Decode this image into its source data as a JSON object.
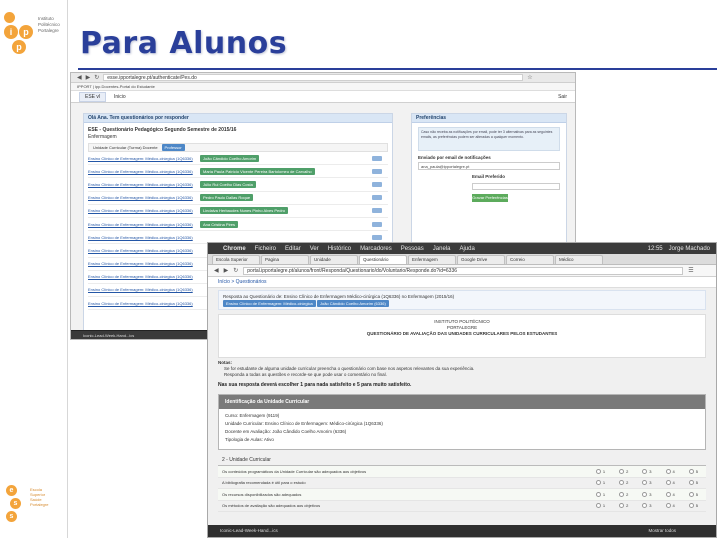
{
  "slide": {
    "title": "Para Alunos",
    "ipp_logo_text": [
      "Instituto",
      "Politécnico",
      "Portalegre"
    ],
    "ipp_logo_letters": [
      "i",
      "p",
      "p"
    ],
    "ess_logo_text": [
      "Escola",
      "Superior",
      "Saúde",
      "Portalegre"
    ],
    "ess_logo_letters": [
      "e",
      "s",
      "s"
    ],
    "title_color": "#2a3f9a",
    "logo_color": "#f3a43b"
  },
  "screenshot1": {
    "url": "esse.ipportalegre.pt/authenticate/Pes.do",
    "bookmarks": "IPPORT  |  ipp.Docentes-Portal do Estudante",
    "app_tab": "ESE vl",
    "app_home": "Inicio",
    "user": "Sair",
    "panel_title": "Olá Ana. Tem questionários por responder",
    "survey_title": "ESE - Questionário Pedagógico Segundo Semestre de 2015/16",
    "course": "Enfermagem",
    "uc_header_label": "Unidade Curricular (Turma) Docente",
    "uc_header_chip": "Professor",
    "rows": [
      {
        "uc": "Ensino Clínico de Enfermagem: Médico-cirúrgica (1Q6336)",
        "teacher": "João Cândido Coelho Amorim"
      },
      {
        "uc": "Ensino Clínico de Enfermagem: Médico-cirúrgica (1Q6336)",
        "teacher": "Maria Paula Patrício Vicente Pereira Bartolomeu de Carvalho"
      },
      {
        "uc": "Ensino Clínico de Enfermagem: Médico-cirúrgica (1Q6336)",
        "teacher": "Júlio Rui Coelho Dias Costa"
      },
      {
        "uc": "Ensino Clínico de Enfermagem: Médico-cirúrgica (1Q6336)",
        "teacher": "Pedro Paulo Dallas Roque"
      },
      {
        "uc": "Ensino Clínico de Enfermagem: Médico-cirúrgica (1Q6336)",
        "teacher": "Lindalva Herbaudes Nunes Pinho Alves Pedro"
      },
      {
        "uc": "Ensino Clínico de Enfermagem: Médico-cirúrgica (1Q6336)",
        "teacher": "Ana Cristina Pires"
      },
      {
        "uc": "Ensino Clínico de Enfermagem: Médico-cirúrgica (1Q6336)",
        "teacher": ""
      },
      {
        "uc": "Ensino Clínico de Enfermagem: Médico-cirúrgica (1Q6336)",
        "teacher": ""
      },
      {
        "uc": "Ensino Clínico de Enfermagem: Médico-cirúrgica (1Q6336)",
        "teacher": ""
      },
      {
        "uc": "Ensino Clínico de Enfermagem: Médico-cirúrgica (1Q6336)",
        "teacher": ""
      },
      {
        "uc": "Ensino Clínico de Enfermagem: Médico-cirúrgica (1Q6336)",
        "teacher": ""
      },
      {
        "uc": "Ensino Clínico de Enfermagem: Médico-cirúrgica (1Q6336)",
        "teacher": ""
      }
    ],
    "side_title": "Preferências",
    "side_note": "Caso não receba as notificações por email, pode ter 3 alternativas para as seguintes emails, as preferências podem ser alteradas a qualquer momento.",
    "side_email_label": "Enviado por email de notificações",
    "side_email_value": "ana_paula@ipportalegre.pt",
    "side_field_label": "Email Preferido",
    "side_button": "Gravar Preferências",
    "status": "Iconic-Lead-Week-Hand...ics"
  },
  "screenshot2": {
    "menu": [
      "Chrome",
      "Ficheiro",
      "Editar",
      "Ver",
      "Histórico",
      "Marcadores",
      "Pessoas",
      "Janela",
      "Ajuda"
    ],
    "menu_right": "Jorge Machado",
    "clock": "12:55",
    "tabs": [
      "Escola Superior",
      "Pagina",
      "Unidade",
      "Questionário",
      "Enfermagem",
      "Google Drive",
      "Correio",
      "Médico"
    ],
    "url": "portal.ipportalegre.pt/alunos/front/Responda/Questionario/do/Voluntario/Responde.do?id=6336",
    "breadcrumb": "Início > Questionários",
    "ident_line1": "Resposta ao Questionário de: Ensino Clínico de Enfermagem Médico-cirúrgica (1Q6336) no Enfermagem (2015/16)",
    "ident_line2": "Docente: João Cândido Coelho Amorim",
    "ident_chip1": "Ensino Clínico de Enfermagem: Médico-cirúrgica",
    "ident_chip2": "João Cândido Coelho Amorim (6336)",
    "doc_lines": [
      "INSTITUTO POLITÉCNICO",
      "PORTALEGRE",
      "QUESTIONÁRIO DE AVALIAÇÃO DAS UNIDADES CURRICULARES PELOS ESTUDANTES"
    ],
    "note_title": "Notas:",
    "notes": [
      "Se for estudante de alguma unidade curricular preencha o questionário com base nos aspetos relevantes da sua experiência.",
      "Responda a todas as questões e recorde-se que pode usar o comentário no final."
    ],
    "warning": "Nas sua resposta deverá escolher 1 para nada satisfeito e 5 para muito satisfeito.",
    "section_title": "Identificação da Unidade Curricular",
    "section_rows": [
      "Curso: Enfermagem (9119)",
      "Unidade Curricular: Ensino Clínico de Enfermagem: Médico-cirúrgica (1Q6336)",
      "Docente em Avaliação: João Cândido Coelho Amorim (6336)",
      "Tipologia de Aulas: Ativo"
    ],
    "questions_head": "2 - Unidade Curricular",
    "questions": [
      "Os conteúdos programáticos da Unidade Curricular são adequados aos objetivos",
      "A bibliografia recomendada é útil para o estudo",
      "Os recursos disponibilizados são adequados",
      "Os métodos de avaliação são adequados aos objetivos"
    ],
    "scale": [
      "1",
      "2",
      "3",
      "4",
      "5"
    ],
    "status_left": "Iconic-Lead-Week-Hand...ics",
    "status_right": "Mostrar todos"
  }
}
